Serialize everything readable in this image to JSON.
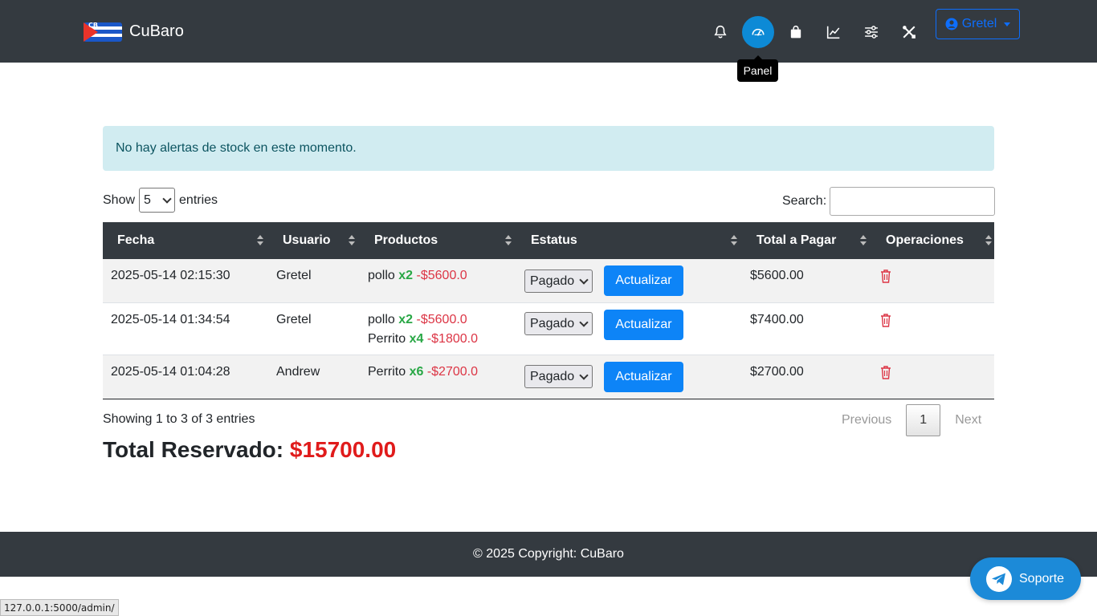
{
  "nav": {
    "brand": "CuBaro",
    "user": "Gretel",
    "tooltip": "Panel",
    "icons": [
      "bell-icon",
      "speedometer-icon",
      "bag-icon",
      "chart-line-icon",
      "sliders-icon",
      "tools-icon"
    ]
  },
  "alert": {
    "text": "No hay alertas de stock en este momento."
  },
  "controls": {
    "show_label": "Show",
    "entries_label": "entries",
    "page_size": "5",
    "search_label": "Search:",
    "search_value": ""
  },
  "table": {
    "headers": [
      "Fecha",
      "Usuario",
      "Productos",
      "Estatus",
      "Total a Pagar",
      "Operaciones"
    ],
    "rows": [
      {
        "fecha": "2025-05-14 02:15:30",
        "usuario": "Gretel",
        "productos": [
          {
            "name": "pollo",
            "qty": "x2",
            "price": "-$5600.0"
          }
        ],
        "estatus": "Pagado",
        "action": "Actualizar",
        "total": "$5600.00"
      },
      {
        "fecha": "2025-05-14 01:34:54",
        "usuario": "Gretel",
        "productos": [
          {
            "name": "pollo",
            "qty": "x2",
            "price": "-$5600.0"
          },
          {
            "name": "Perrito",
            "qty": "x4",
            "price": "-$1800.0"
          }
        ],
        "estatus": "Pagado",
        "action": "Actualizar",
        "total": "$7400.00"
      },
      {
        "fecha": "2025-05-14 01:04:28",
        "usuario": "Andrew",
        "productos": [
          {
            "name": "Perrito",
            "qty": "x6",
            "price": "-$2700.0"
          }
        ],
        "estatus": "Pagado",
        "action": "Actualizar",
        "total": "$2700.00"
      }
    ]
  },
  "pagination": {
    "info": "Showing 1 to 3 of 3 entries",
    "previous": "Previous",
    "current": "1",
    "next": "Next"
  },
  "summary": {
    "label": "Total Reservado:",
    "amount": "$15700.00"
  },
  "footer": {
    "copyright": "© 2025 Copyright: CuBaro"
  },
  "support": {
    "label": "Soporte"
  },
  "statusbar": {
    "url": "127.0.0.1:5000/admin/"
  },
  "colors": {
    "navbar": "#343a40",
    "accent": "#0d84f7",
    "qty": "#28a745",
    "price": "#dc3545",
    "total": "#e01b1b"
  }
}
